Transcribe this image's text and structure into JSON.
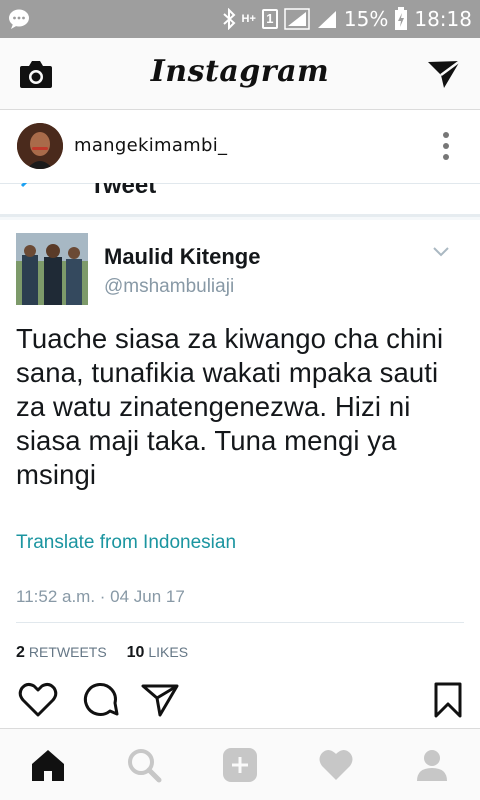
{
  "status_bar": {
    "network_type": "H+",
    "sim_number": "1",
    "battery": "15%",
    "time": "18:18"
  },
  "header": {
    "logo": "Instagram"
  },
  "post": {
    "username": "mangekimambi_"
  },
  "tweet": {
    "cut_header": "Tweet",
    "name": "Maulid Kitenge",
    "handle": "@mshambuliaji",
    "body": "Tuache siasa za kiwango cha chini sana, tunafikia wakati mpaka sauti za watu zinatengenezwa. Hizi ni siasa maji taka. Tuna mengi ya msingi",
    "translate": "Translate from Indonesian",
    "timestamp": "11:52 a.m. · 04 Jun 17",
    "retweets_count": "2",
    "retweets_label": "RETWEETS",
    "likes_count": "10",
    "likes_label": "LIKES"
  },
  "icons": {
    "status": [
      "chat-bubble-icon",
      "bluetooth-icon",
      "signal-icon",
      "battery-charging-icon"
    ],
    "header": [
      "camera-icon",
      "direct-send-icon"
    ],
    "actions": [
      "like-heart-icon",
      "comment-icon",
      "share-send-icon",
      "bookmark-icon"
    ],
    "tabs": [
      "home-icon",
      "search-icon",
      "add-post-icon",
      "activity-heart-icon",
      "profile-icon"
    ]
  },
  "colors": {
    "status_bar": "#9e9e9e",
    "twitter_link": "#1b95a0",
    "secondary_text": "#8899a6"
  }
}
